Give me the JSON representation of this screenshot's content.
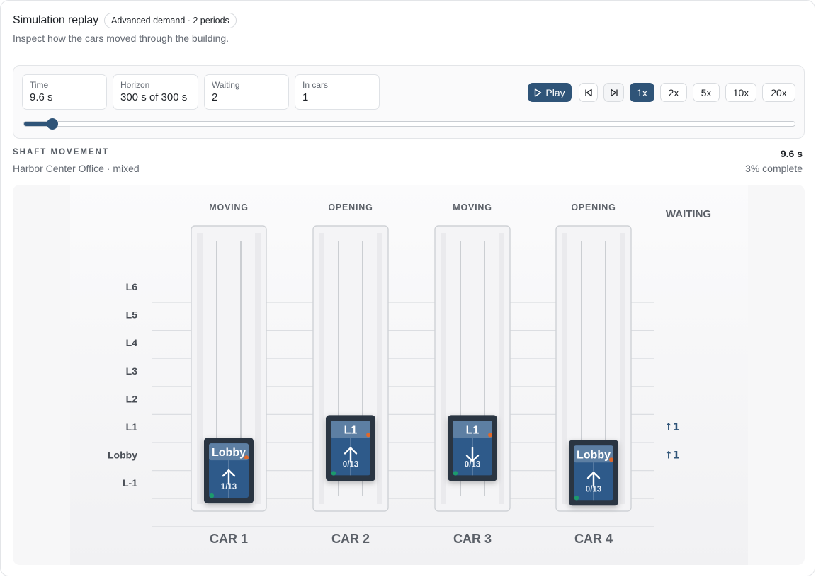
{
  "header": {
    "title": "Simulation replay",
    "badge": "Advanced demand · 2 periods",
    "subtitle": "Inspect how the cars moved through the building."
  },
  "stats": [
    {
      "label": "Time",
      "value": "9.6 s"
    },
    {
      "label": "Horizon",
      "value": "300 s of 300 s"
    },
    {
      "label": "Waiting",
      "value": "2"
    },
    {
      "label": "In cars",
      "value": "1"
    }
  ],
  "playback": {
    "play_label": "Play",
    "play_icon": "play-icon",
    "step_back_icon": "step-back-icon",
    "step_forward_icon": "step-forward-icon",
    "speeds": [
      "1x",
      "2x",
      "5x",
      "10x",
      "20x"
    ],
    "active_speed": "1x",
    "progress_fraction": 0.037
  },
  "section": {
    "label": "SHAFT MOVEMENT",
    "subtitle": "Harbor Center Office · mixed",
    "time": "9.6 s",
    "complete": "3% complete"
  },
  "floors": [
    "L6",
    "L5",
    "L4",
    "L3",
    "L2",
    "L1",
    "Lobby",
    "L-1"
  ],
  "waiting_header": "WAITING",
  "waiting": [
    {
      "floor": "L1",
      "text": "↑1"
    },
    {
      "floor": "Lobby",
      "text": "↑1"
    }
  ],
  "cars": [
    {
      "name": "CAR 1",
      "status": "MOVING",
      "floor_label": "Lobby",
      "load": "1/13",
      "direction": "up",
      "position_floor": 1.5
    },
    {
      "name": "CAR 2",
      "status": "OPENING",
      "floor_label": "L1",
      "load": "0/13",
      "direction": "up",
      "position_floor": 2.3
    },
    {
      "name": "CAR 3",
      "status": "MOVING",
      "floor_label": "L1",
      "load": "0/13",
      "direction": "down",
      "position_floor": 2.3
    },
    {
      "name": "CAR 4",
      "status": "OPENING",
      "floor_label": "Lobby",
      "load": "0/13",
      "direction": "up",
      "position_floor": 1.42
    }
  ],
  "colors": {
    "accent": "#2f5478",
    "car_body": "#2b3442",
    "car_cabin": "#2e5a8a",
    "dot_green": "#1f9a6c",
    "dot_orange": "#e0672a"
  }
}
